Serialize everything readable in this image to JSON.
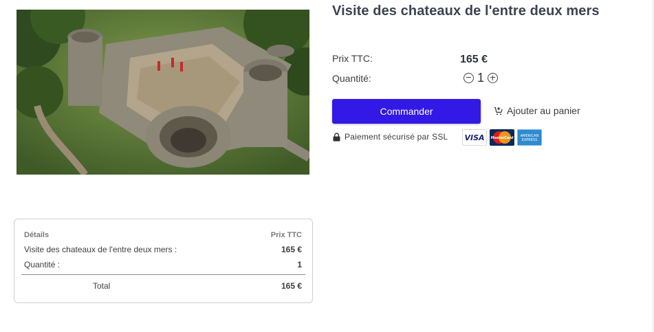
{
  "product": {
    "title": "Visite des chateaux de l'entre deux mers",
    "image_alt": "aerial view of castle ruins"
  },
  "pricing": {
    "price_label": "Prix TTC:",
    "price_value": "165 €",
    "quantity_label": "Quantité:",
    "quantity_value": "1"
  },
  "actions": {
    "order_label": "Commander",
    "cart_label": "Ajouter au panier"
  },
  "security": {
    "text": "Paiement sécurisé par SSL",
    "cards": [
      "VISA",
      "MasterCard",
      "American Express"
    ]
  },
  "summary": {
    "header_left": "Détails",
    "header_right": "Prix TTC",
    "item_label": "Visite des chateaux de l'entre deux mers :",
    "item_price": "165 €",
    "qty_label": "Quantité :",
    "qty_value": "1",
    "total_label": "Total",
    "total_value": "165 €"
  },
  "colors": {
    "accent": "#3319e6",
    "title": "#3b4351"
  }
}
